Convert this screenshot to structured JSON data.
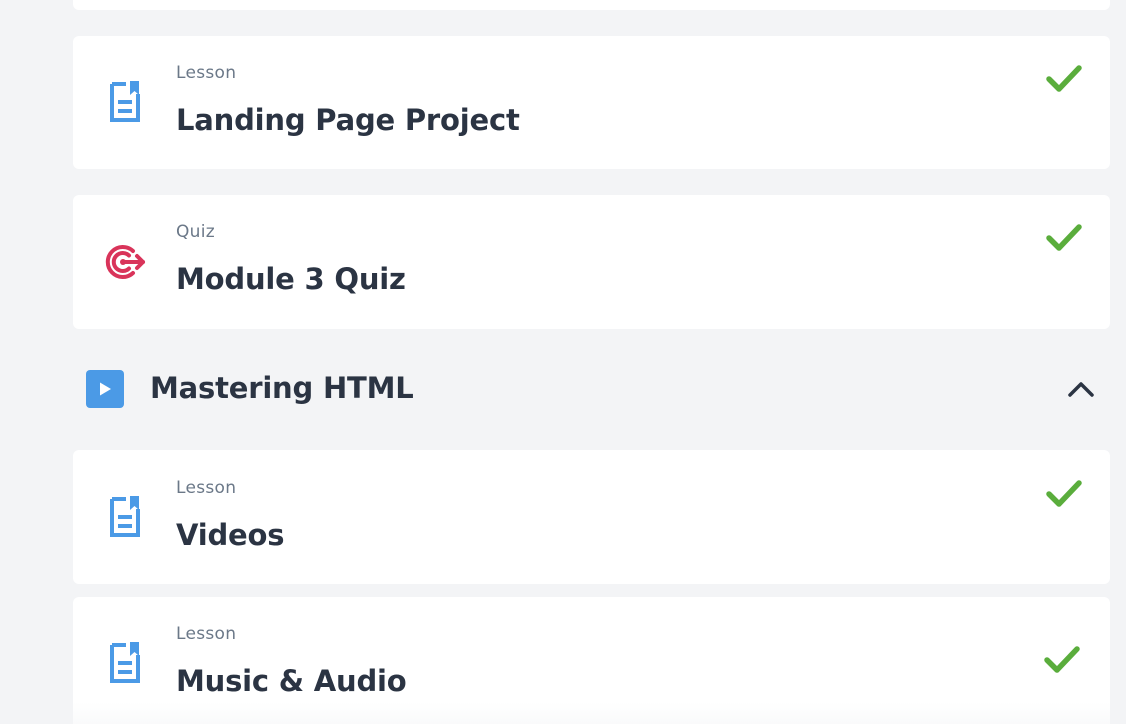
{
  "colors": {
    "background": "#f3f4f6",
    "card": "#ffffff",
    "lesson_icon": "#4b9ae6",
    "quiz_icon": "#d9345a",
    "check": "#5aad3c",
    "title_text": "#2b3443",
    "type_text": "#6b7888"
  },
  "items_before": [
    {
      "type_label": "Lesson",
      "title": "Landing Page Project",
      "icon": "lesson-document-icon",
      "completed": true
    },
    {
      "type_label": "Quiz",
      "title": "Module 3 Quiz",
      "icon": "quiz-target-icon",
      "completed": true
    }
  ],
  "section": {
    "title": "Mastering HTML",
    "icon": "play-icon",
    "expanded": true,
    "toggle_icon": "chevron-up-icon"
  },
  "section_items": [
    {
      "type_label": "Lesson",
      "title": "Videos",
      "icon": "lesson-document-icon",
      "completed": true
    },
    {
      "type_label": "Lesson",
      "title": "Music & Audio",
      "icon": "lesson-document-icon",
      "completed": true
    }
  ]
}
